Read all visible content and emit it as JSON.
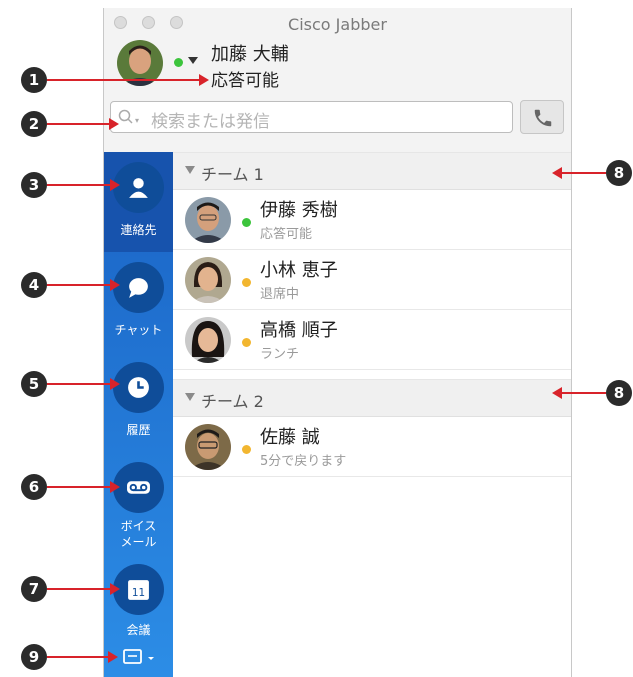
{
  "window": {
    "title": "Cisco Jabber"
  },
  "me": {
    "name": "加藤 大輔",
    "status": "応答可能",
    "status_color": "#3cc43c"
  },
  "search": {
    "placeholder": "検索または発信"
  },
  "sidebar": {
    "items": [
      {
        "label": "連絡先",
        "icon": "contacts-icon"
      },
      {
        "label": "チャット",
        "icon": "chat-icon"
      },
      {
        "label": "履歴",
        "icon": "history-icon"
      },
      {
        "label": "ボイス\nメール",
        "icon": "voicemail-icon"
      },
      {
        "label": "会議",
        "icon": "calendar-icon",
        "icon_text": "11"
      }
    ],
    "bottom_icon": "workspace-menu-icon"
  },
  "groups": [
    {
      "label": "チーム 1",
      "contacts": [
        {
          "name": "伊藤 秀樹",
          "status": "応答可能",
          "status_color": "#3cc43c"
        },
        {
          "name": "小林 恵子",
          "status": "退席中",
          "status_color": "#f2b630"
        },
        {
          "name": "高橋 順子",
          "status": "ランチ",
          "status_color": "#f2b630"
        }
      ]
    },
    {
      "label": "チーム 2",
      "contacts": [
        {
          "name": "佐藤 誠",
          "status": "5分で戻ります",
          "status_color": "#f2b630"
        }
      ]
    }
  ],
  "callouts": [
    "1",
    "2",
    "3",
    "4",
    "5",
    "6",
    "7",
    "8",
    "8",
    "9"
  ],
  "colors": {
    "sidebar": "#1a63c5",
    "callout_arrow": "#d8232a"
  }
}
